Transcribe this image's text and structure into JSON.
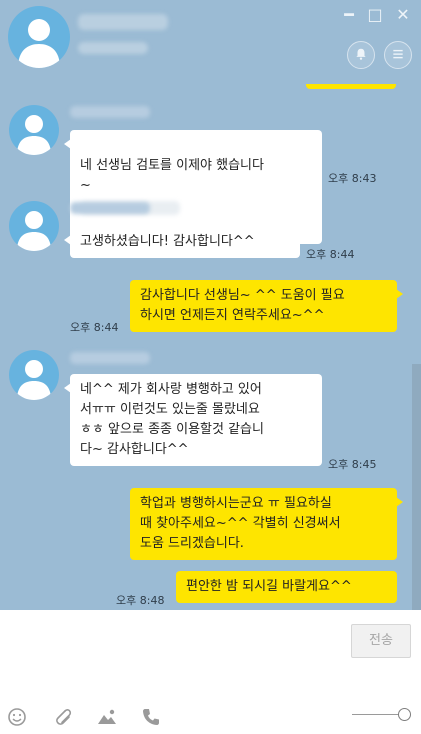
{
  "header": {
    "window_controls": {
      "minimize": "━",
      "maximize": "□",
      "close": "✕"
    },
    "bell_icon": "bell-icon",
    "menu_icon": "menu-icon"
  },
  "colors": {
    "chat_bg": "#9bbbd4",
    "outgoing_bubble": "#fee500",
    "incoming_bubble": "#ffffff",
    "avatar": "#67b3df"
  },
  "messages": [
    {
      "direction": "in",
      "text": "네 선생님 검토를 이제야 했습니다\n~",
      "time": "오후 8:43"
    },
    {
      "direction": "in",
      "text": "고생하셨습니다! 감사합니다^^",
      "time": "오후 8:44"
    },
    {
      "direction": "out",
      "text": "감사합니다 선생님~ ^^ 도움이 필요\n하시면 언제든지 연락주세요~^^",
      "time": "오후 8:44"
    },
    {
      "direction": "in",
      "text": "네^^ 제가 회사랑 병행하고 있어\n서ㅠㅠ 이런것도 있는줄 몰랐네요\nㅎㅎ 앞으로 종종 이용할것 같습니\n다~ 감사합니다^^",
      "time": "오후 8:45"
    },
    {
      "direction": "out",
      "text": "학업과 병행하시는군요 ㅠ 필요하실\n때 찾아주세요~^^ 각별히 신경써서\n도움 드리겠습니다.",
      "time": ""
    },
    {
      "direction": "out",
      "text": "편안한 밤 되시길 바랄게요^^",
      "time": "오후 8:48"
    }
  ],
  "input": {
    "placeholder": "",
    "value": "",
    "send_label": "전송"
  },
  "toolbar": {
    "icons": [
      "emoji-icon",
      "attach-icon",
      "image-icon",
      "phone-icon"
    ]
  }
}
